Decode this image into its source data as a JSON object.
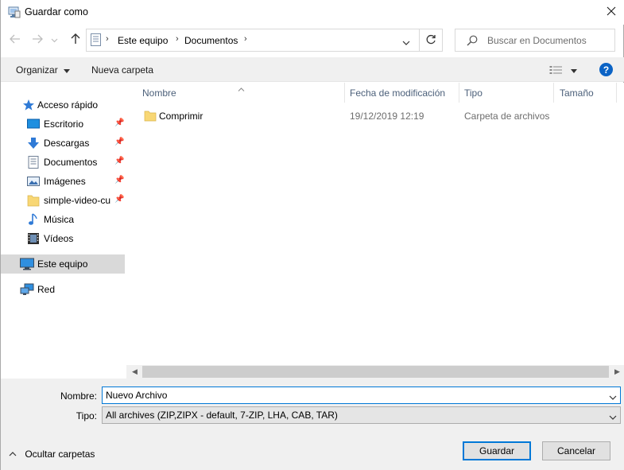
{
  "titlebar": {
    "title": "Guardar como",
    "icon": "save-dialog-icon",
    "close_icon": "close-icon"
  },
  "nav": {
    "back_icon": "arrow-left-icon",
    "forward_icon": "arrow-right-icon",
    "recent_icon": "chevron-down-icon",
    "up_icon": "arrow-up-icon",
    "breadcrumbs": [
      "Este equipo",
      "Documentos"
    ],
    "refresh_icon": "refresh-icon",
    "search_placeholder": "Buscar en Documentos",
    "search_icon": "search-icon"
  },
  "toolbar": {
    "organize_label": "Organizar",
    "new_folder_label": "Nueva carpeta",
    "view_icon": "view-options-icon",
    "help_label": "?"
  },
  "sidebar": {
    "items": [
      {
        "label": "Acceso rápido",
        "icon": "star-icon",
        "pinned": false
      },
      {
        "label": "Escritorio",
        "icon": "desktop-icon",
        "pinned": true
      },
      {
        "label": "Descargas",
        "icon": "download-icon",
        "pinned": true
      },
      {
        "label": "Documentos",
        "icon": "document-icon",
        "pinned": true
      },
      {
        "label": "Imágenes",
        "icon": "pictures-icon",
        "pinned": true
      },
      {
        "label": "simple-video-cu",
        "icon": "folder-icon",
        "pinned": true
      },
      {
        "label": "Música",
        "icon": "music-icon",
        "pinned": false
      },
      {
        "label": "Vídeos",
        "icon": "video-icon",
        "pinned": false
      },
      {
        "label": "Este equipo",
        "icon": "computer-icon",
        "pinned": false,
        "selected": true
      },
      {
        "label": "Red",
        "icon": "network-icon",
        "pinned": false
      }
    ]
  },
  "table": {
    "columns": [
      "Nombre",
      "Fecha de modificación",
      "Tipo",
      "Tamaño"
    ],
    "rows": [
      {
        "name": "Comprimir",
        "modified": "19/12/2019 12:19",
        "type": "Carpeta de archivos",
        "size": ""
      }
    ]
  },
  "bottom": {
    "name_label": "Nombre:",
    "name_value": "Nuevo Archivo",
    "type_label": "Tipo:",
    "type_value": "All archives (ZIP,ZIPX - default, 7-ZIP, LHA, CAB, TAR)",
    "hide_folders_label": "Ocultar carpetas",
    "save_label": "Guardar",
    "cancel_label": "Cancelar"
  },
  "colors": {
    "accent": "#0078d7",
    "selection": "#d9d9d9",
    "folder": "#f8d775",
    "header_text": "#4c607a"
  }
}
